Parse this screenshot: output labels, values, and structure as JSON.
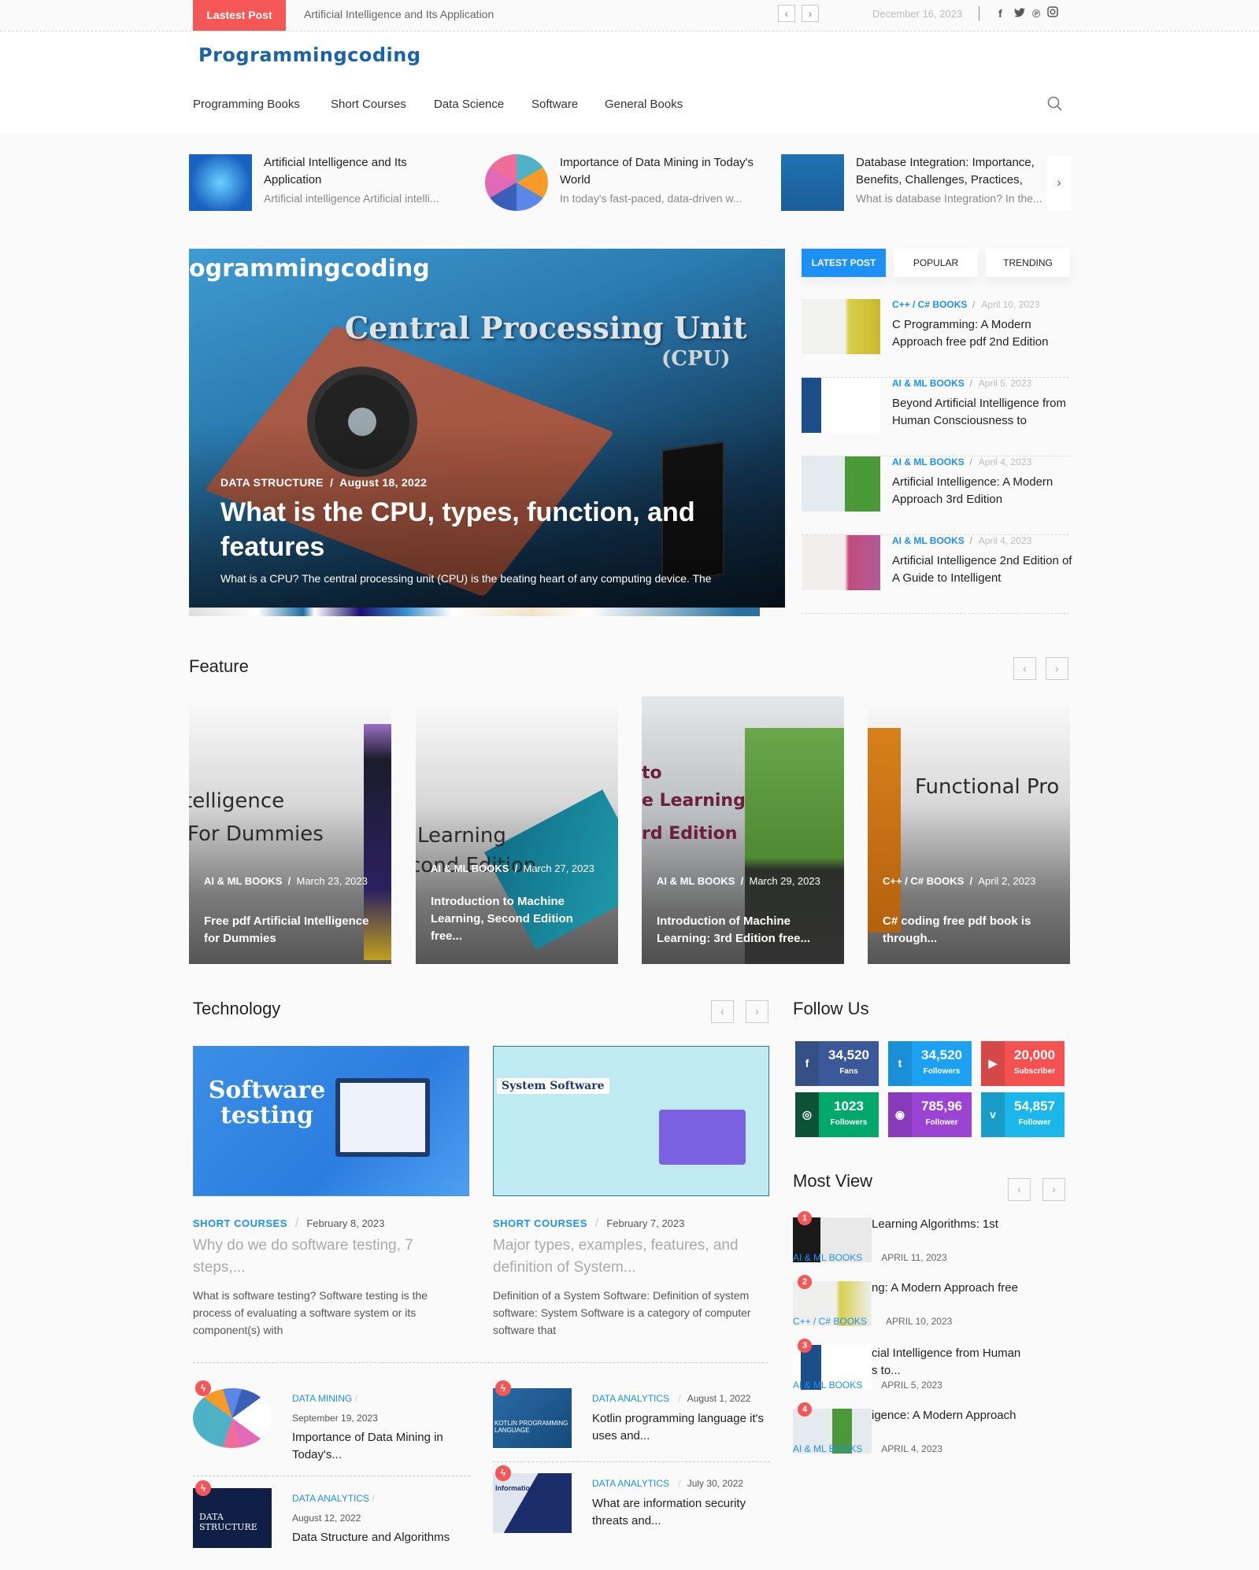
{
  "topbar": {
    "badge": "Lastest Post",
    "ticker": "Artificial Intelligence and Its Application",
    "prev": "‹",
    "next": "›",
    "date": "December 16, 2023",
    "social": [
      "f",
      "t",
      "p",
      "ig"
    ]
  },
  "header": {
    "logo": "Programmingcoding",
    "nav": [
      "Programming Books",
      "Short Courses",
      "Data Science",
      "Software",
      "General Books"
    ]
  },
  "strip": [
    {
      "title": "Artificial Intelligence and Its Application",
      "excerpt": "Artificial intelligence Artificial intelli..."
    },
    {
      "title": "Importance of Data Mining in Today's World",
      "excerpt": "In today's fast-paced, data-driven w..."
    },
    {
      "title": "Database Integration: Importance, Benefits, Challenges, Practices,",
      "excerpt": "What is database Integration? In the..."
    }
  ],
  "hero": {
    "image_logo": "ogrammingcoding",
    "image_heading": "Central Processing Unit",
    "image_sub": "(CPU)",
    "category": "DATA STRUCTURE",
    "date": "August 18, 2022",
    "title": "What is the CPU, types, function, and features",
    "excerpt": "What is a CPU? The central processing unit (CPU) is the beating heart of any computing device. The"
  },
  "tabs": [
    "LATEST POST",
    "POPULAR",
    "TRENDING"
  ],
  "latest": [
    {
      "cat": "C++ / C# BOOKS",
      "date": "April 10, 2023",
      "title": "C Programming: A Modern Approach free pdf 2nd Edition"
    },
    {
      "cat": "AI & ML BOOKS",
      "date": "April 5, 2023",
      "title": "Beyond Artificial Intelligence from Human Consciousness to"
    },
    {
      "cat": "AI & ML BOOKS",
      "date": "April 4, 2023",
      "title": "Artificial Intelligence: A Modern Approach 3rd Edition"
    },
    {
      "cat": "AI & ML BOOKS",
      "date": "April 4, 2023",
      "title": "Artificial Intelligence 2nd Edition of A Guide to Intelligent"
    }
  ],
  "feature": {
    "title": "Feature",
    "cards": [
      {
        "img_text": [
          "telligence",
          "For Dummies"
        ],
        "cat": "AI & ML BOOKS",
        "date": "March 23, 2023",
        "title": "Free pdf Artificial Intelligence for Dummies"
      },
      {
        "img_text": [
          "Learning",
          "cond Edition"
        ],
        "cat": "AI & ML BOOKS",
        "date": "March 27, 2023",
        "title": "Introduction to Machine Learning, Second Edition free..."
      },
      {
        "img_text": [
          "to",
          "e Learning",
          "rd Edition"
        ],
        "cat": "AI & ML BOOKS",
        "date": "March 29, 2023",
        "title": "Introduction of Machine Learning: 3rd Edition free..."
      },
      {
        "img_text": [
          "Functional Pro"
        ],
        "cat": "C++ / C# BOOKS",
        "date": "April 2, 2023",
        "title": "C# coding free pdf book is through..."
      }
    ]
  },
  "technology": {
    "title": "Technology",
    "posts": [
      {
        "img_text": "Software testing",
        "cat": "SHORT COURSES",
        "date": "February 8, 2023",
        "title": "Why do we do software testing, 7 steps,...",
        "excerpt": "What is software testing? Software testing is the process of evaluating a software system or its component(s) with"
      },
      {
        "img_text": "System Software",
        "cat": "SHORT COURSES",
        "date": "February 7, 2023",
        "title": "Major types, examples, features, and definition of System...",
        "excerpt": "Definition of a System Software: Definition of system software: System Software is a category of computer software that"
      }
    ],
    "mini": [
      {
        "cat": "DATA MINING",
        "date": "September 19, 2023",
        "title": "Importance of Data Mining in Today's..."
      },
      {
        "cat": "DATA ANALYTICS",
        "date": "August 12, 2022",
        "title": "Data Structure and Algorithms",
        "thumb_text": "DATA STRUCTURE"
      },
      {
        "cat": "DATA ANALYTICS",
        "date": "August 1, 2022",
        "title": "Kotlin programming language it's uses and...",
        "thumb_text": "KOTLIN PROGRAMMING LANGUAGE"
      },
      {
        "cat": "DATA ANALYTICS",
        "date": "July 30, 2022",
        "title": "What are information security threats and...",
        "thumb_text": "Information Security"
      }
    ]
  },
  "follow": {
    "title": "Follow Us",
    "items": [
      {
        "net": "facebook",
        "icon": "f",
        "num": "34,520",
        "label": "Fans",
        "color": "#3b5998",
        "dark": "#344e86"
      },
      {
        "net": "twitter",
        "icon": "t",
        "num": "34,520",
        "label": "Followers",
        "color": "#1da1f2",
        "dark": "#1a8fd6"
      },
      {
        "net": "youtube",
        "icon": "▶",
        "num": "20,000",
        "label": "Subscriber",
        "color": "#f55151",
        "dark": "#d44848"
      },
      {
        "net": "dribbble",
        "icon": "◎",
        "num": "1023",
        "label": "Followers",
        "color": "#00a86b",
        "dark": "#0b5236"
      },
      {
        "net": "instagram",
        "icon": "◉",
        "num": "785,96",
        "label": "Follower",
        "color": "#9b44d4",
        "dark": "#873bb9"
      },
      {
        "net": "vine",
        "icon": "v",
        "num": "54,857",
        "label": "Follower",
        "color": "#1cb7ea",
        "dark": "#1a9cc8"
      }
    ]
  },
  "most_view": {
    "title": "Most View",
    "items": [
      {
        "rank": "1",
        "title": "Learning Algorithms: 1st",
        "cat": "AI & ML BOOKS",
        "date": "APRIL 11, 2023"
      },
      {
        "rank": "2",
        "title": "ng: A Modern Approach free",
        "cat": "C++ / C# BOOKS",
        "date": "APRIL 10, 2023"
      },
      {
        "rank": "3",
        "title": "cial Intelligence from Human s to...",
        "cat": "AI & ML BOOKS",
        "date": "APRIL 5, 2023"
      },
      {
        "rank": "4",
        "title": "igence: A Modern Approach",
        "cat": "AI & ML BOOKS",
        "date": "APRIL 4, 2023"
      }
    ]
  }
}
